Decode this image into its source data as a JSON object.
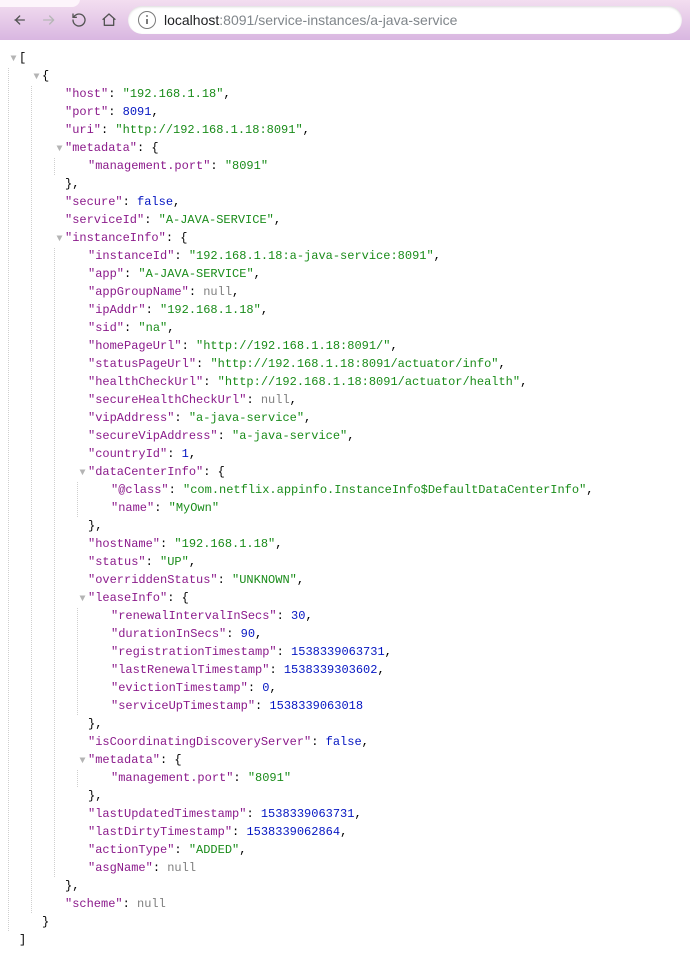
{
  "url": {
    "host": "localhost",
    "port": ":8091",
    "path": "/service-instances/a-java-service"
  },
  "json": [
    {
      "d": 0,
      "tw": "▼",
      "txt": "[",
      "cls": "pun"
    },
    {
      "d": 1,
      "tw": "▼",
      "txt": "{",
      "cls": "pun"
    },
    {
      "d": 2,
      "key": "host",
      "vtxt": "\"192.168.1.18\"",
      "vcls": "str",
      "comma": true
    },
    {
      "d": 2,
      "key": "port",
      "vtxt": "8091",
      "vcls": "num",
      "comma": true
    },
    {
      "d": 2,
      "key": "uri",
      "vtxt": "\"http://192.168.1.18:8091\"",
      "vcls": "str",
      "comma": true
    },
    {
      "d": 2,
      "tw": "▼",
      "key": "metadata",
      "vtxt": "{",
      "vcls": "pun"
    },
    {
      "d": 3,
      "key": "management.port",
      "vtxt": "\"8091\"",
      "vcls": "str"
    },
    {
      "d": 2,
      "txt": "},",
      "cls": "pun"
    },
    {
      "d": 2,
      "key": "secure",
      "vtxt": "false",
      "vcls": "bool",
      "comma": true
    },
    {
      "d": 2,
      "key": "serviceId",
      "vtxt": "\"A-JAVA-SERVICE\"",
      "vcls": "str",
      "comma": true
    },
    {
      "d": 2,
      "tw": "▼",
      "key": "instanceInfo",
      "vtxt": "{",
      "vcls": "pun"
    },
    {
      "d": 3,
      "key": "instanceId",
      "vtxt": "\"192.168.1.18:a-java-service:8091\"",
      "vcls": "str",
      "comma": true
    },
    {
      "d": 3,
      "key": "app",
      "vtxt": "\"A-JAVA-SERVICE\"",
      "vcls": "str",
      "comma": true
    },
    {
      "d": 3,
      "key": "appGroupName",
      "vtxt": "null",
      "vcls": "null",
      "comma": true
    },
    {
      "d": 3,
      "key": "ipAddr",
      "vtxt": "\"192.168.1.18\"",
      "vcls": "str",
      "comma": true
    },
    {
      "d": 3,
      "key": "sid",
      "vtxt": "\"na\"",
      "vcls": "str",
      "comma": true
    },
    {
      "d": 3,
      "key": "homePageUrl",
      "vtxt": "\"http://192.168.1.18:8091/\"",
      "vcls": "str",
      "comma": true
    },
    {
      "d": 3,
      "key": "statusPageUrl",
      "vtxt": "\"http://192.168.1.18:8091/actuator/info\"",
      "vcls": "str",
      "comma": true
    },
    {
      "d": 3,
      "key": "healthCheckUrl",
      "vtxt": "\"http://192.168.1.18:8091/actuator/health\"",
      "vcls": "str",
      "comma": true
    },
    {
      "d": 3,
      "key": "secureHealthCheckUrl",
      "vtxt": "null",
      "vcls": "null",
      "comma": true
    },
    {
      "d": 3,
      "key": "vipAddress",
      "vtxt": "\"a-java-service\"",
      "vcls": "str",
      "comma": true
    },
    {
      "d": 3,
      "key": "secureVipAddress",
      "vtxt": "\"a-java-service\"",
      "vcls": "str",
      "comma": true
    },
    {
      "d": 3,
      "key": "countryId",
      "vtxt": "1",
      "vcls": "num",
      "comma": true
    },
    {
      "d": 3,
      "tw": "▼",
      "key": "dataCenterInfo",
      "vtxt": "{",
      "vcls": "pun"
    },
    {
      "d": 4,
      "key": "@class",
      "vtxt": "\"com.netflix.appinfo.InstanceInfo$DefaultDataCenterInfo\"",
      "vcls": "str",
      "comma": true
    },
    {
      "d": 4,
      "key": "name",
      "vtxt": "\"MyOwn\"",
      "vcls": "str"
    },
    {
      "d": 3,
      "txt": "},",
      "cls": "pun"
    },
    {
      "d": 3,
      "key": "hostName",
      "vtxt": "\"192.168.1.18\"",
      "vcls": "str",
      "comma": true
    },
    {
      "d": 3,
      "key": "status",
      "vtxt": "\"UP\"",
      "vcls": "str",
      "comma": true
    },
    {
      "d": 3,
      "key": "overriddenStatus",
      "vtxt": "\"UNKNOWN\"",
      "vcls": "str",
      "comma": true
    },
    {
      "d": 3,
      "tw": "▼",
      "key": "leaseInfo",
      "vtxt": "{",
      "vcls": "pun"
    },
    {
      "d": 4,
      "key": "renewalIntervalInSecs",
      "vtxt": "30",
      "vcls": "num",
      "comma": true
    },
    {
      "d": 4,
      "key": "durationInSecs",
      "vtxt": "90",
      "vcls": "num",
      "comma": true
    },
    {
      "d": 4,
      "key": "registrationTimestamp",
      "vtxt": "1538339063731",
      "vcls": "num",
      "comma": true
    },
    {
      "d": 4,
      "key": "lastRenewalTimestamp",
      "vtxt": "1538339303602",
      "vcls": "num",
      "comma": true
    },
    {
      "d": 4,
      "key": "evictionTimestamp",
      "vtxt": "0",
      "vcls": "num",
      "comma": true
    },
    {
      "d": 4,
      "key": "serviceUpTimestamp",
      "vtxt": "1538339063018",
      "vcls": "num"
    },
    {
      "d": 3,
      "txt": "},",
      "cls": "pun"
    },
    {
      "d": 3,
      "key": "isCoordinatingDiscoveryServer",
      "vtxt": "false",
      "vcls": "bool",
      "comma": true
    },
    {
      "d": 3,
      "tw": "▼",
      "key": "metadata",
      "vtxt": "{",
      "vcls": "pun"
    },
    {
      "d": 4,
      "key": "management.port",
      "vtxt": "\"8091\"",
      "vcls": "str"
    },
    {
      "d": 3,
      "txt": "},",
      "cls": "pun"
    },
    {
      "d": 3,
      "key": "lastUpdatedTimestamp",
      "vtxt": "1538339063731",
      "vcls": "num",
      "comma": true
    },
    {
      "d": 3,
      "key": "lastDirtyTimestamp",
      "vtxt": "1538339062864",
      "vcls": "num",
      "comma": true
    },
    {
      "d": 3,
      "key": "actionType",
      "vtxt": "\"ADDED\"",
      "vcls": "str",
      "comma": true
    },
    {
      "d": 3,
      "key": "asgName",
      "vtxt": "null",
      "vcls": "null"
    },
    {
      "d": 2,
      "txt": "},",
      "cls": "pun"
    },
    {
      "d": 2,
      "key": "scheme",
      "vtxt": "null",
      "vcls": "null"
    },
    {
      "d": 1,
      "txt": "}",
      "cls": "pun"
    },
    {
      "d": 0,
      "txt": "]",
      "cls": "pun"
    }
  ]
}
